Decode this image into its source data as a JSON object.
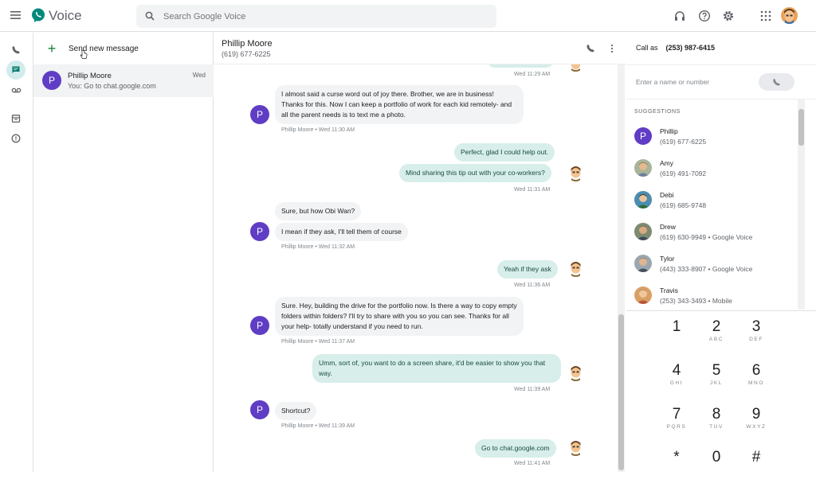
{
  "app": {
    "name": "Voice"
  },
  "search": {
    "placeholder": "Search Google Voice"
  },
  "header_icons": [
    "headset-icon",
    "help-icon",
    "settings-icon",
    "apps-grid-icon"
  ],
  "nav": [
    "calls",
    "messages",
    "voicemail",
    "archive",
    "spam"
  ],
  "list": {
    "new_message_label": "Send new message",
    "conversations": [
      {
        "initial": "P",
        "name": "Phillip Moore",
        "preview": "You: Go to chat.google.com",
        "date": "Wed"
      }
    ]
  },
  "chat": {
    "contact_name": "Phillip Moore",
    "contact_number": "(619) 677-6225",
    "top_meta": "Wed 11:29 AM",
    "messages": [
      {
        "dir": "in",
        "text": "I almost said a curse word out of joy there.  Brother, we are in business! Thanks for this.  Now I can keep a portfolio of work for each kid remotely- and all the parent needs is to text me a photo.",
        "meta": "Phillip Moore • Wed 11:30 AM"
      },
      {
        "dir": "out",
        "text": "Perfect, glad I could help out."
      },
      {
        "dir": "out",
        "text": "Mind sharing this tip out with your co-workers?",
        "meta": "Wed 11:31 AM"
      },
      {
        "dir": "in",
        "text": "Sure, but how Obi Wan?"
      },
      {
        "dir": "in",
        "text": "I mean if they ask, I'll tell them of course",
        "meta": "Phillip Moore • Wed 11:32 AM"
      },
      {
        "dir": "out",
        "text": "Yeah if they ask",
        "meta": "Wed 11:36 AM"
      },
      {
        "dir": "in",
        "text": "Sure.  Hey, building the drive for the portfolio now.  Is there a way to copy empty folders within folders?  I'll try to share with you so you can see. Thanks for all your help- totally understand if you need to run.",
        "meta": "Phillip Moore • Wed 11:37 AM"
      },
      {
        "dir": "out",
        "text": "Umm, sort of, you want to do a screen share, it'd be easier to show you that way.",
        "meta": "Wed 11:39 AM"
      },
      {
        "dir": "in",
        "text": "Shortcut?",
        "meta": "Phillip Moore • Wed 11:39 AM"
      },
      {
        "dir": "out",
        "text": "Go to chat.google.com",
        "meta": "Wed 11:41 AM"
      }
    ]
  },
  "dialer": {
    "call_as_label": "Call as",
    "call_as_number": "(253) 987-6415",
    "input_placeholder": "Enter a name or number",
    "suggestions_title": "SUGGESTIONS",
    "suggestions": [
      {
        "name": "Phillip",
        "number": "(619) 677-6225"
      },
      {
        "name": "Amy",
        "number": "(619) 491-7092"
      },
      {
        "name": "Debi",
        "number": "(619) 685-9748"
      },
      {
        "name": "Drew",
        "number": "(619) 630-9949 • Google Voice"
      },
      {
        "name": "Tylor",
        "number": "(443) 333-8907 • Google Voice"
      },
      {
        "name": "Travis",
        "number": "(253) 343-3493 • Mobile"
      }
    ],
    "keys": [
      {
        "digit": "1",
        "letters": ""
      },
      {
        "digit": "2",
        "letters": "ABC"
      },
      {
        "digit": "3",
        "letters": "DEF"
      },
      {
        "digit": "4",
        "letters": "GHI"
      },
      {
        "digit": "5",
        "letters": "JKL"
      },
      {
        "digit": "6",
        "letters": "MNO"
      },
      {
        "digit": "7",
        "letters": "PQRS"
      },
      {
        "digit": "8",
        "letters": "TUV"
      },
      {
        "digit": "9",
        "letters": "WXYZ"
      },
      {
        "digit": "*",
        "letters": ""
      },
      {
        "digit": "0",
        "letters": ""
      },
      {
        "digit": "#",
        "letters": ""
      }
    ]
  },
  "colors": {
    "accent": "#00796b",
    "avatar_purple": "#5f3dc4",
    "outgoing_bubble": "#d7eeea",
    "incoming_bubble": "#f1f3f4"
  }
}
